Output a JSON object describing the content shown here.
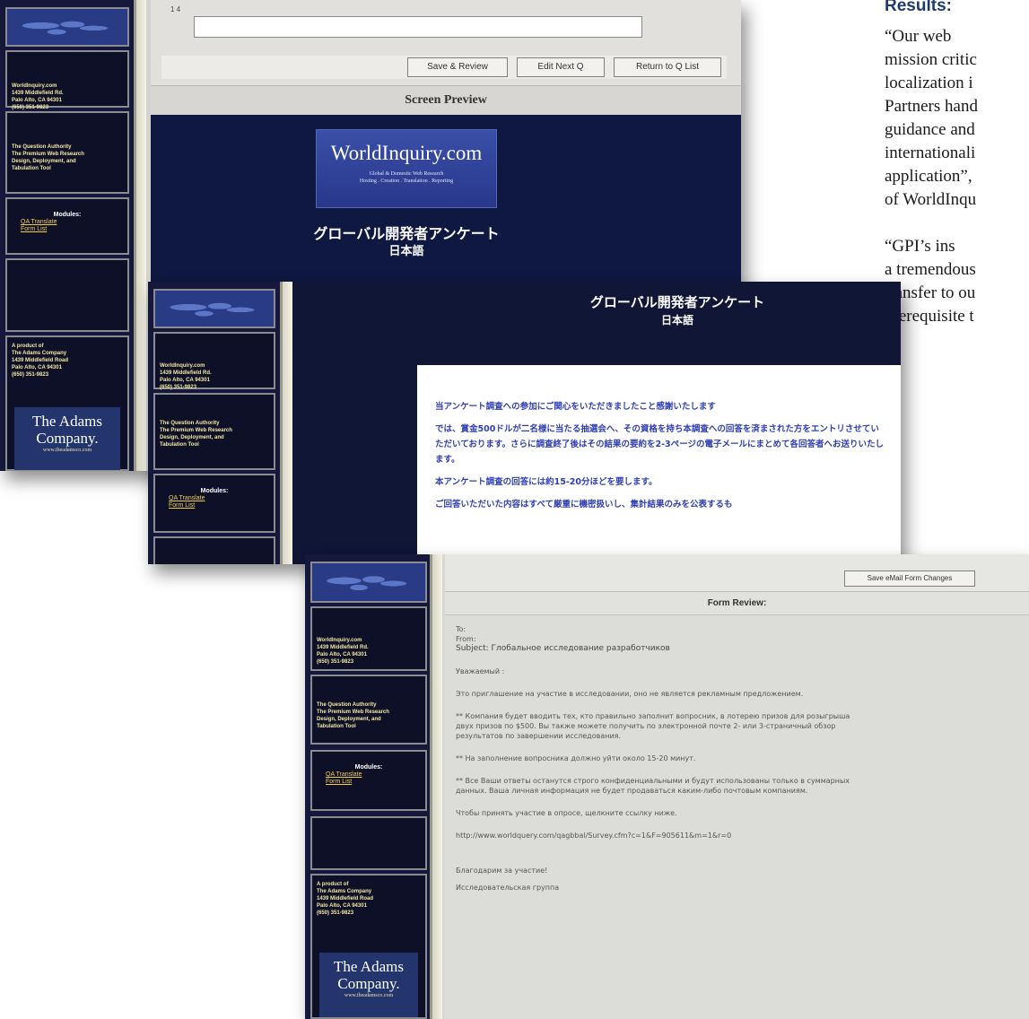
{
  "article": {
    "heading": "Results:",
    "lines": [
      "“Our web",
      "mission critic",
      "localization i",
      "Partners hand",
      "guidance and",
      "internationali",
      "application”,",
      "of WorldInqu",
      "“GPI’s ins",
      "a tremendous",
      "transfer to ou",
      "prerequisite t"
    ]
  },
  "sidebar": {
    "company_lines": [
      "WorldInquiry.com",
      "1439 Middlefield Rd.",
      "Palo Alto, CA  94301",
      "(650) 351-9823"
    ],
    "tagline_lines": [
      "The Question Authority",
      "The Premium Web Research",
      "Design, Deployment, and",
      "Tabulation Tool"
    ],
    "modules_title": "Modules:",
    "modules_links": [
      "QA Translate",
      "Form List"
    ],
    "product_lines": [
      "A product of",
      "The Adams Company",
      "1439 Middlefield Road",
      "Palo Alto, CA 94301",
      "(650) 351-9823"
    ],
    "adams_name1": "The Adams",
    "adams_name2": "Company.",
    "adams_url": "www.theadamsco.com"
  },
  "shot1": {
    "input_marker": "1  4",
    "buttons": [
      "Save & Review",
      "Edit Next Q",
      "Return to Q List"
    ],
    "preview_title": "Screen Preview",
    "logo_title": "WorldInquiry.com",
    "logo_sub1": "Global & Domestic Web Research",
    "logo_sub2": "Hosting . Creation . Translation . Reporting",
    "jp_title": "グローバル開発者アンケート",
    "jp_lang": "日本語"
  },
  "shot2": {
    "jp_title": "グローバル開発者アンケート",
    "jp_lang": "日本語",
    "paragraphs": [
      "当アンケート調査への参加にご関心をいただきましたこと感謝いたします",
      "では、賞金500ドルが二名様に当たる抽選会へ、その資格を持ち本調査への回答を済まされた方をエントリさせていただいております。さらに調査終了後はその結果の要約を2-3ページの電子メールにまとめて各回答者へお送りいたします。",
      "本アンケート調査の回答には約15-20分ほどを要します。",
      "ご回答いただいた内容はすべて厳重に機密扱いし、集計結果のみを公表するも"
    ]
  },
  "shot3": {
    "save_button": "Save eMail Form Changes",
    "form_title": "Form Review:",
    "mail_lines": [
      "To:",
      "From:",
      "Subject: Глобальное исследование разработчиков",
      "",
      "Уважаемый :",
      "",
      "Это приглашение на участие в исследовании, оно не является рекламным предложением.",
      "",
      "** Компания будет вводить тех, кто правильно заполнит вопросник, в лотерею призов для розыгрыша",
      "двух призов по $500. Вы также можете получить по электронной почте 2- или 3-страничный обзор",
      "результатов по завершении исследования.",
      "",
      "** На заполнение вопросника должно уйти около 15-20 минут.",
      "",
      "** Все Ваши ответы останутся строго конфиденциальными и будут использованы только в суммарных",
      "данных. Ваша личная информация не будет продаваться каким-либо почтовым компаниям.",
      "",
      "Чтобы принять участие в опросе, щелкните ссылку ниже.",
      "",
      "http://www.worldquery.com/qagbbal/Survey.cfm?c=1&F=905611&m=1&r=0",
      "",
      "",
      "Благодарим за участие!",
      "",
      "Исследовательская группа"
    ]
  }
}
